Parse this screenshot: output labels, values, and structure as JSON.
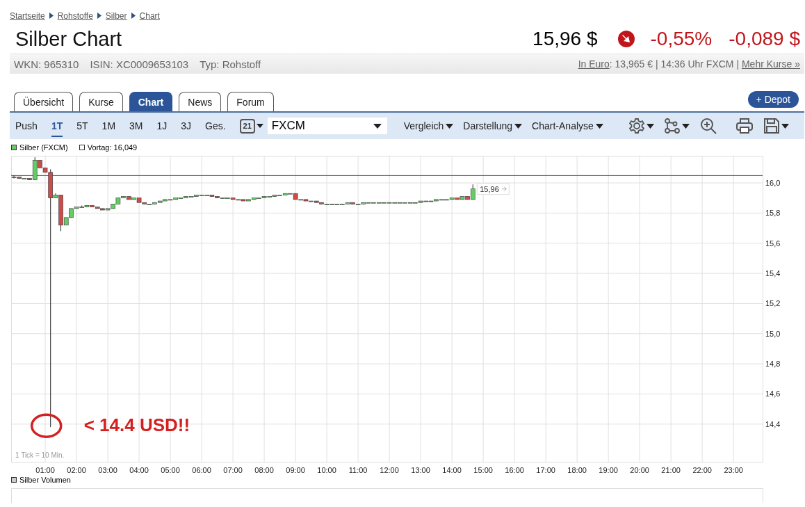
{
  "breadcrumb": [
    "Startseite",
    "Rohstoffe",
    "Silber",
    "Chart"
  ],
  "title": "Silber Chart",
  "quote": {
    "price": "15,96 $",
    "falling": true,
    "change_percent": "-0,55%",
    "change_abs": "-0,089 $"
  },
  "info": {
    "fields": [
      "WKN: 965310",
      "ISIN: XC0009653103",
      "Typ: Rohstoff"
    ],
    "euro_link": "In Euro",
    "euro_text": ": 13,965 € | 14:36 Uhr FXCM | ",
    "more_link": "Mehr Kurse »"
  },
  "tabs": [
    {
      "label": "Übersicht",
      "selected": false
    },
    {
      "label": "Kurse",
      "selected": false
    },
    {
      "label": "Chart",
      "selected": true
    },
    {
      "label": "News",
      "selected": false
    },
    {
      "label": "Forum",
      "selected": false
    }
  ],
  "depot_button": "+ Depot",
  "periods": [
    {
      "label": "Push",
      "selected": false
    },
    {
      "label": "1T",
      "selected": true
    },
    {
      "label": "5T",
      "selected": false
    },
    {
      "label": "1M",
      "selected": false
    },
    {
      "label": "3M",
      "selected": false
    },
    {
      "label": "1J",
      "selected": false
    },
    {
      "label": "3J",
      "selected": false
    },
    {
      "label": "Ges.",
      "selected": false
    }
  ],
  "calendar_day": "21",
  "exchange": "FXCM",
  "menus": [
    "Vergleich",
    "Darstellung",
    "Chart-Analyse"
  ],
  "legend": {
    "series": "Silber (FXCM)",
    "previous": "Vortag: 16,049"
  },
  "tick_note": "1 Tick = 10 Min.",
  "last_price_label": "15,96",
  "volume_legend": "Silber Volumen",
  "chart_data": {
    "type": "candlestick",
    "grid": true,
    "xlim": [
      -0.09,
      23.93
    ],
    "ylim": [
      14.15,
      16.18
    ],
    "xticks": [
      {
        "value": 1,
        "label": "01:00"
      },
      {
        "value": 2,
        "label": "02:00"
      },
      {
        "value": 3,
        "label": "03:00"
      },
      {
        "value": 4,
        "label": "04:00"
      },
      {
        "value": 5,
        "label": "05:00"
      },
      {
        "value": 6,
        "label": "06:00"
      },
      {
        "value": 7,
        "label": "07:00"
      },
      {
        "value": 8,
        "label": "08:00"
      },
      {
        "value": 9,
        "label": "09:00"
      },
      {
        "value": 10,
        "label": "10:00"
      },
      {
        "value": 11,
        "label": "11:00"
      },
      {
        "value": 12,
        "label": "12:00"
      },
      {
        "value": 13,
        "label": "13:00"
      },
      {
        "value": 14,
        "label": "14:00"
      },
      {
        "value": 15,
        "label": "15:00"
      },
      {
        "value": 16,
        "label": "16:00"
      },
      {
        "value": 17,
        "label": "17:00"
      },
      {
        "value": 18,
        "label": "18:00"
      },
      {
        "value": 19,
        "label": "19:00"
      },
      {
        "value": 20,
        "label": "20:00"
      },
      {
        "value": 21,
        "label": "21:00"
      },
      {
        "value": 22,
        "label": "22:00"
      },
      {
        "value": 23,
        "label": "23:00"
      }
    ],
    "yticks": [
      {
        "value": 14.4,
        "label": "14,4"
      },
      {
        "value": 14.6,
        "label": "14,6"
      },
      {
        "value": 14.8,
        "label": "14,8"
      },
      {
        "value": 15.0,
        "label": "15,0"
      },
      {
        "value": 15.2,
        "label": "15,2"
      },
      {
        "value": 15.4,
        "label": "15,4"
      },
      {
        "value": 15.6,
        "label": "15,6"
      },
      {
        "value": 15.8,
        "label": "15,8"
      },
      {
        "value": 16.0,
        "label": "16,0"
      }
    ],
    "x": [
      0,
      0.17,
      0.33,
      0.5,
      0.67,
      0.83,
      1,
      1.17,
      1.33,
      1.5,
      1.67,
      1.83,
      2,
      2.17,
      2.33,
      2.5,
      2.67,
      2.83,
      3,
      3.17,
      3.33,
      3.5,
      3.67,
      3.83,
      4,
      4.17,
      4.33,
      4.5,
      4.67,
      4.83,
      5,
      5.17,
      5.33,
      5.5,
      5.67,
      5.83,
      6,
      6.17,
      6.33,
      6.5,
      6.67,
      6.83,
      7,
      7.17,
      7.33,
      7.5,
      7.67,
      7.83,
      8,
      8.17,
      8.33,
      8.5,
      8.67,
      8.83,
      9,
      9.17,
      9.33,
      9.5,
      9.67,
      9.83,
      10,
      10.17,
      10.33,
      10.5,
      10.67,
      10.83,
      11,
      11.17,
      11.33,
      11.5,
      11.67,
      11.83,
      12,
      12.17,
      12.33,
      12.5,
      12.67,
      12.83,
      13,
      13.17,
      13.33,
      13.5,
      13.67,
      13.83,
      14,
      14.17,
      14.33,
      14.5,
      14.67
    ],
    "ohlc": [
      [
        16.04,
        16.05,
        16.03,
        16.04
      ],
      [
        16.04,
        16.04,
        16.03,
        16.03
      ],
      [
        16.03,
        16.03,
        16.03,
        16.03
      ],
      [
        16.03,
        16.03,
        16.02,
        16.02
      ],
      [
        16.02,
        16.17,
        16.02,
        16.15
      ],
      [
        16.15,
        16.15,
        16.1,
        16.1
      ],
      [
        16.1,
        16.1,
        16.07,
        16.07
      ],
      [
        16.07,
        16.09,
        14.38,
        15.9
      ],
      [
        15.9,
        15.93,
        15.9,
        15.92
      ],
      [
        15.92,
        15.92,
        15.68,
        15.72
      ],
      [
        15.72,
        15.77,
        15.72,
        15.77
      ],
      [
        15.77,
        15.83,
        15.77,
        15.83
      ],
      [
        15.83,
        15.84,
        15.83,
        15.84
      ],
      [
        15.84,
        15.85,
        15.84,
        15.84
      ],
      [
        15.84,
        15.85,
        15.84,
        15.85
      ],
      [
        15.85,
        15.85,
        15.84,
        15.84
      ],
      [
        15.84,
        15.84,
        15.83,
        15.83
      ],
      [
        15.83,
        15.83,
        15.82,
        15.82
      ],
      [
        15.82,
        15.83,
        15.82,
        15.83
      ],
      [
        15.83,
        15.86,
        15.83,
        15.86
      ],
      [
        15.86,
        15.9,
        15.86,
        15.9
      ],
      [
        15.9,
        15.91,
        15.9,
        15.91
      ],
      [
        15.91,
        15.91,
        15.89,
        15.89
      ],
      [
        15.89,
        15.9,
        15.89,
        15.9
      ],
      [
        15.9,
        15.9,
        15.87,
        15.87
      ],
      [
        15.87,
        15.87,
        15.86,
        15.86
      ],
      [
        15.86,
        15.86,
        15.86,
        15.86
      ],
      [
        15.86,
        15.87,
        15.86,
        15.87
      ],
      [
        15.87,
        15.88,
        15.87,
        15.88
      ],
      [
        15.88,
        15.89,
        15.88,
        15.89
      ],
      [
        15.89,
        15.89,
        15.89,
        15.89
      ],
      [
        15.89,
        15.9,
        15.89,
        15.9
      ],
      [
        15.9,
        15.9,
        15.9,
        15.9
      ],
      [
        15.9,
        15.91,
        15.9,
        15.91
      ],
      [
        15.91,
        15.91,
        15.91,
        15.91
      ],
      [
        15.91,
        15.92,
        15.91,
        15.92
      ],
      [
        15.92,
        15.92,
        15.92,
        15.92
      ],
      [
        15.92,
        15.92,
        15.92,
        15.92
      ],
      [
        15.92,
        15.92,
        15.91,
        15.91
      ],
      [
        15.91,
        15.91,
        15.9,
        15.9
      ],
      [
        15.9,
        15.9,
        15.9,
        15.9
      ],
      [
        15.9,
        15.9,
        15.9,
        15.9
      ],
      [
        15.9,
        15.9,
        15.89,
        15.89
      ],
      [
        15.89,
        15.89,
        15.89,
        15.89
      ],
      [
        15.89,
        15.89,
        15.88,
        15.88
      ],
      [
        15.88,
        15.89,
        15.88,
        15.89
      ],
      [
        15.89,
        15.9,
        15.89,
        15.9
      ],
      [
        15.9,
        15.9,
        15.9,
        15.9
      ],
      [
        15.9,
        15.91,
        15.9,
        15.91
      ],
      [
        15.91,
        15.91,
        15.91,
        15.91
      ],
      [
        15.91,
        15.92,
        15.91,
        15.92
      ],
      [
        15.92,
        15.92,
        15.92,
        15.92
      ],
      [
        15.92,
        15.93,
        15.92,
        15.93
      ],
      [
        15.93,
        15.93,
        15.93,
        15.93
      ],
      [
        15.93,
        15.93,
        15.89,
        15.89
      ],
      [
        15.89,
        15.89,
        15.89,
        15.89
      ],
      [
        15.89,
        15.89,
        15.88,
        15.88
      ],
      [
        15.88,
        15.88,
        15.88,
        15.88
      ],
      [
        15.88,
        15.88,
        15.87,
        15.87
      ],
      [
        15.87,
        15.87,
        15.86,
        15.86
      ],
      [
        15.86,
        15.86,
        15.86,
        15.86
      ],
      [
        15.86,
        15.86,
        15.86,
        15.86
      ],
      [
        15.86,
        15.86,
        15.86,
        15.86
      ],
      [
        15.86,
        15.86,
        15.86,
        15.86
      ],
      [
        15.86,
        15.87,
        15.86,
        15.87
      ],
      [
        15.87,
        15.87,
        15.86,
        15.86
      ],
      [
        15.86,
        15.86,
        15.86,
        15.86
      ],
      [
        15.86,
        15.87,
        15.86,
        15.87
      ],
      [
        15.87,
        15.87,
        15.87,
        15.87
      ],
      [
        15.87,
        15.87,
        15.87,
        15.87
      ],
      [
        15.87,
        15.87,
        15.87,
        15.87
      ],
      [
        15.87,
        15.87,
        15.87,
        15.87
      ],
      [
        15.87,
        15.87,
        15.87,
        15.87
      ],
      [
        15.87,
        15.87,
        15.87,
        15.87
      ],
      [
        15.87,
        15.87,
        15.87,
        15.87
      ],
      [
        15.87,
        15.87,
        15.87,
        15.87
      ],
      [
        15.87,
        15.87,
        15.87,
        15.87
      ],
      [
        15.87,
        15.87,
        15.87,
        15.87
      ],
      [
        15.87,
        15.88,
        15.87,
        15.88
      ],
      [
        15.88,
        15.88,
        15.88,
        15.88
      ],
      [
        15.88,
        15.88,
        15.88,
        15.88
      ],
      [
        15.88,
        15.89,
        15.88,
        15.89
      ],
      [
        15.89,
        15.89,
        15.89,
        15.89
      ],
      [
        15.89,
        15.89,
        15.89,
        15.89
      ],
      [
        15.89,
        15.9,
        15.89,
        15.9
      ],
      [
        15.9,
        15.9,
        15.89,
        15.89
      ],
      [
        15.89,
        15.91,
        15.89,
        15.91
      ],
      [
        15.91,
        15.91,
        15.89,
        15.89
      ],
      [
        15.89,
        15.99,
        15.89,
        15.96
      ]
    ],
    "ref_lines": [
      {
        "axis": "y",
        "value": 16.049
      }
    ],
    "annotations": [
      "< 14.4 USD!!"
    ]
  }
}
